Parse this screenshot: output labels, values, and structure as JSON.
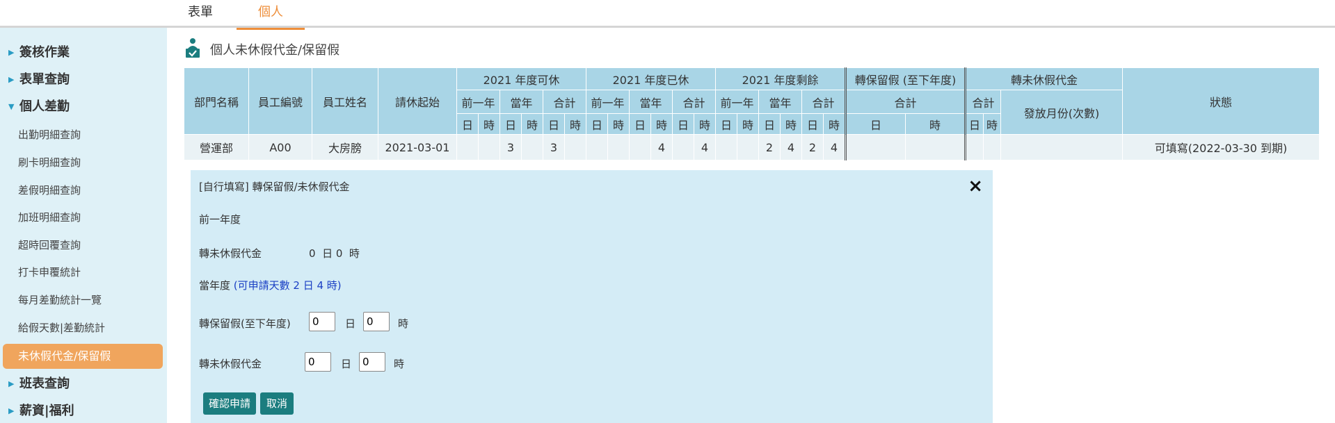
{
  "tabs": [
    {
      "label": "表單"
    },
    {
      "label": "個人"
    }
  ],
  "sidebar": {
    "sections": [
      {
        "label": "簽核作業"
      },
      {
        "label": "表單查詢"
      },
      {
        "label": "個人差勤"
      }
    ],
    "sub_items": [
      {
        "label": "出勤明細查詢"
      },
      {
        "label": "刷卡明細查詢"
      },
      {
        "label": "差假明細查詢"
      },
      {
        "label": "加班明細查詢"
      },
      {
        "label": "超時回覆查詢"
      },
      {
        "label": "打卡申覆統計"
      },
      {
        "label": "每月差勤統計一覽"
      },
      {
        "label": "給假天數|差勤統計"
      },
      {
        "label": "未休假代金/保留假"
      }
    ],
    "bottom_sections": [
      {
        "label": "班表查詢"
      },
      {
        "label": "薪資|福利"
      }
    ]
  },
  "page": {
    "title": "個人未休假代金/保留假"
  },
  "table": {
    "h_dept": "部門名稱",
    "h_empno": "員工編號",
    "h_name": "員工姓名",
    "h_start": "請休起始",
    "h_avail": "2021 年度可休",
    "h_used": "2021 年度已休",
    "h_remain": "2021 年度剩餘",
    "h_reserve": "轉保留假 (至下年度)",
    "h_cash": "轉未休假代金",
    "h_status": "狀態",
    "h_prev": "前一年",
    "h_curr": "當年",
    "h_total": "合計",
    "h_month": "發放月份(次數)",
    "h_day": "日",
    "h_hour": "時",
    "row": {
      "dept": "營運部",
      "empno": "A00",
      "name": "大房膀",
      "start": "2021-03-01",
      "avail_curr_d": "3",
      "avail_total_d": "3",
      "used_curr_h": "4",
      "used_total_h": "4",
      "rem_curr_d": "2",
      "rem_curr_h": "4",
      "rem_total_d": "2",
      "rem_total_h": "4",
      "status": "可填寫(2022-03-30 到期)"
    }
  },
  "popup": {
    "title": "[自行填寫] 轉保留假/未休假代金",
    "close": "×",
    "prev_year": "前一年度",
    "prev_cash_label": "轉未休假代金",
    "prev_cash_value": "0  日 0  時",
    "curr_year": "當年度",
    "curr_available": "(可申請天數 2 日 4 時)",
    "reserve_label": "轉保留假(至下年度)",
    "reserve_day": "0",
    "reserve_hour": "0",
    "cash_label": "轉未休假代金",
    "cash_day": "0",
    "cash_hour": "0",
    "unit_day": "日",
    "unit_hour": "時",
    "confirm": "確認申請",
    "cancel": "取消"
  }
}
